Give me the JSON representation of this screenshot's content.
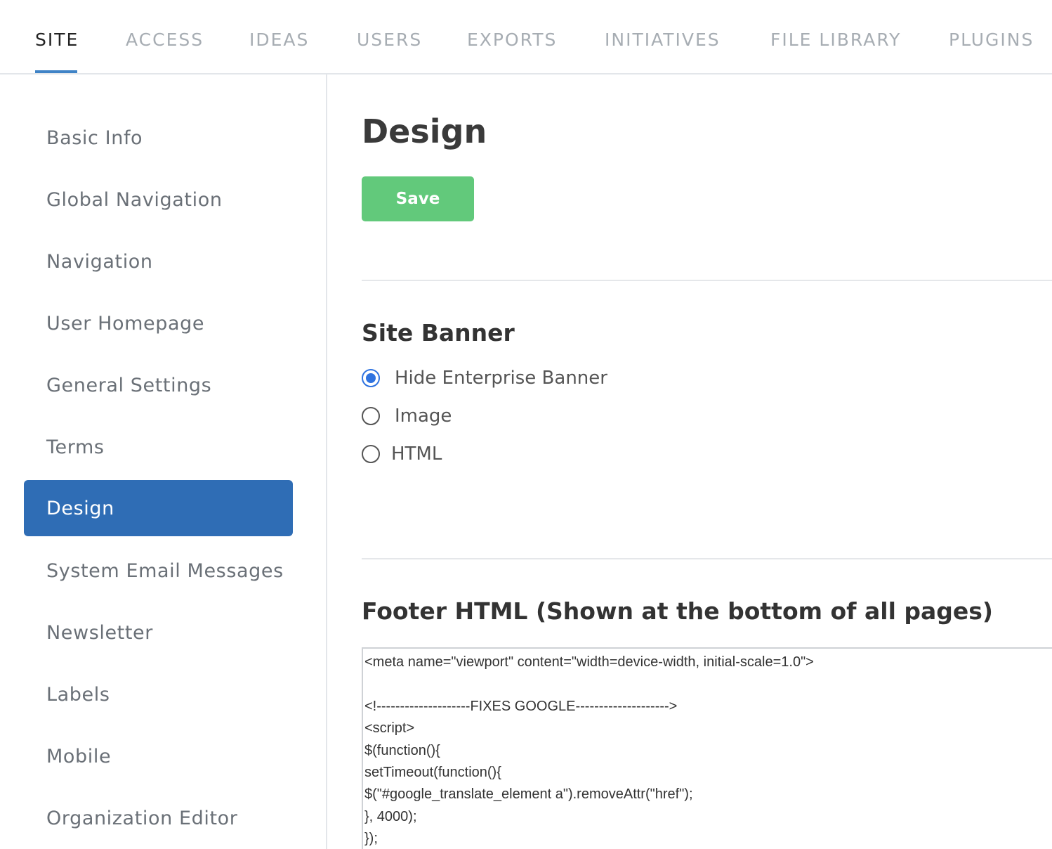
{
  "tabs": [
    {
      "label": "SITE",
      "active": true
    },
    {
      "label": "ACCESS"
    },
    {
      "label": "IDEAS"
    },
    {
      "label": "USERS"
    },
    {
      "label": "EXPORTS"
    },
    {
      "label": "INITIATIVES"
    },
    {
      "label": "FILE LIBRARY"
    },
    {
      "label": "PLUGINS"
    }
  ],
  "sidebar": {
    "items": [
      {
        "label": "Basic Info"
      },
      {
        "label": "Global Navigation"
      },
      {
        "label": "Navigation"
      },
      {
        "label": "User Homepage"
      },
      {
        "label": "General Settings"
      },
      {
        "label": "Terms"
      },
      {
        "label": "Design",
        "active": true
      },
      {
        "label": "System Email Messages"
      },
      {
        "label": "Newsletter"
      },
      {
        "label": "Labels"
      },
      {
        "label": "Mobile"
      },
      {
        "label": "Organization Editor"
      }
    ]
  },
  "main": {
    "title": "Design",
    "save_label": "Save",
    "site_banner": {
      "title": "Site Banner",
      "options": [
        {
          "label": "Hide Enterprise Banner",
          "checked": true
        },
        {
          "label": "Image",
          "checked": false
        },
        {
          "label": "HTML",
          "checked": false
        }
      ]
    },
    "footer": {
      "title": "Footer HTML (Shown at the bottom of all pages)",
      "code": "<meta name=\"viewport\" content=\"width=device-width, initial-scale=1.0\">\n\n<!--------------------FIXES GOOGLE-------------------->\n<script>\n$(function(){\nsetTimeout(function(){\n$(\"#google_translate_element a\").removeAttr(\"href\");\n}, 4000);\n});"
    }
  },
  "colors": {
    "accent": "#2f6db5",
    "tab_underline": "#3f83c6",
    "save_button": "#62c97b",
    "radio_checked": "#2f73e0"
  }
}
